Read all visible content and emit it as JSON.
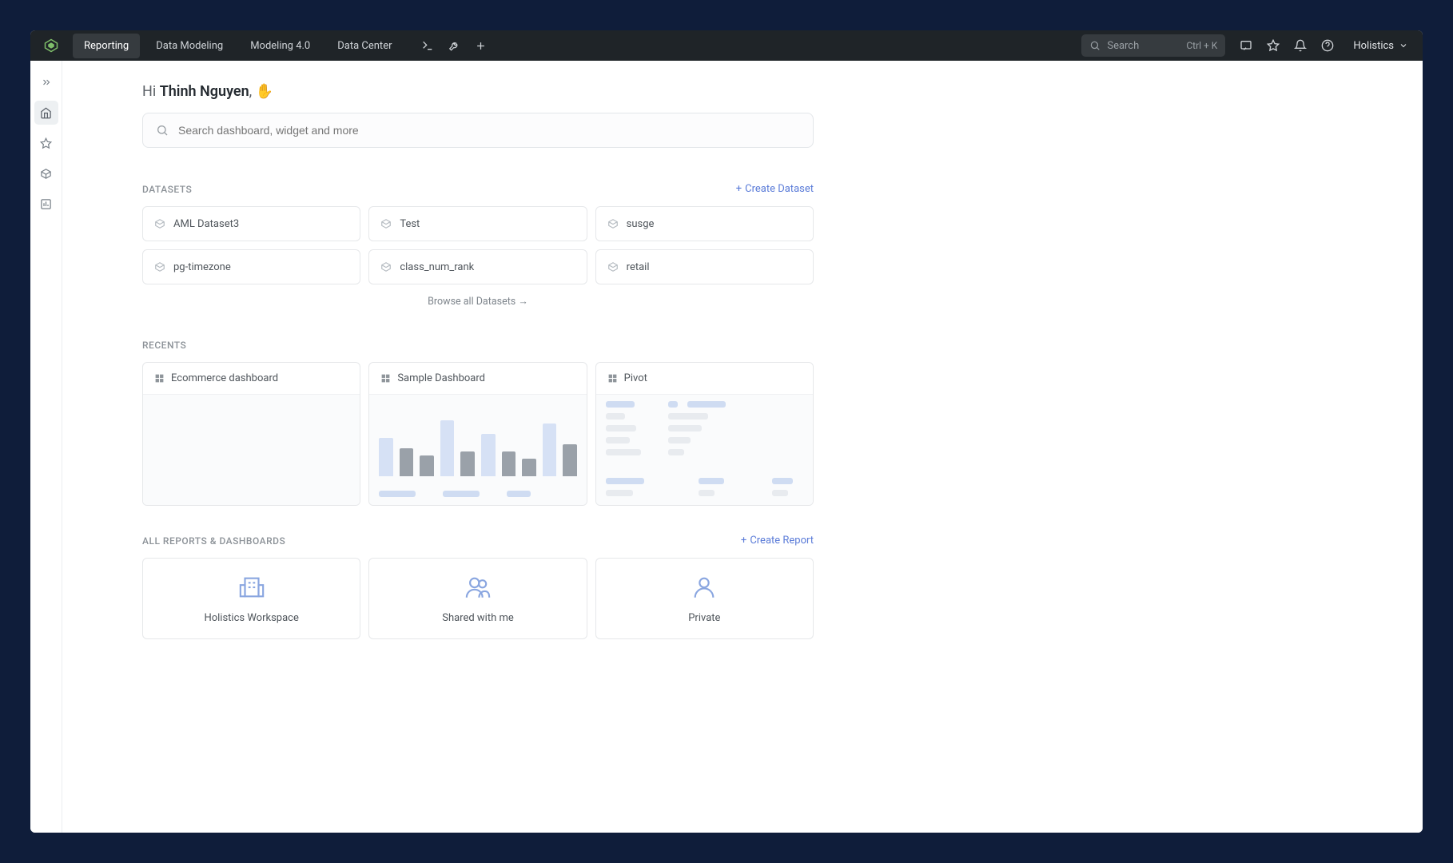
{
  "topnav": {
    "tabs": [
      "Reporting",
      "Data Modeling",
      "Modeling 4.0",
      "Data Center"
    ],
    "search_placeholder": "Search",
    "shortcut": "Ctrl + K",
    "user": "Holistics"
  },
  "greeting": {
    "pre": "Hi ",
    "name": "Thinh Nguyen",
    "post": ", ",
    "emoji": "✋"
  },
  "page_search_placeholder": "Search dashboard, widget and more",
  "datasets": {
    "title": "DATASETS",
    "action": "Create Dataset",
    "items": [
      "AML Dataset3",
      "Test",
      "susge",
      "pg-timezone",
      "class_num_rank",
      "retail"
    ],
    "browse": "Browse all Datasets →"
  },
  "recents": {
    "title": "RECENTS",
    "items": [
      "Ecommerce dashboard",
      "Sample Dashboard",
      "Pivot"
    ]
  },
  "folders": {
    "title": "ALL REPORTS & DASHBOARDS",
    "action": "Create Report",
    "items": [
      "Holistics Workspace",
      "Shared with me",
      "Private"
    ]
  }
}
